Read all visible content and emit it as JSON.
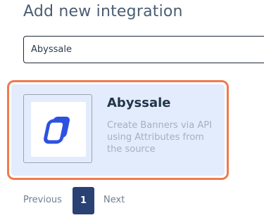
{
  "header": {
    "title": "Add new integration"
  },
  "search": {
    "value": "Abyssale",
    "placeholder": ""
  },
  "integration_card": {
    "name": "Abyssale",
    "description": "Create Banners via API using Attributes from the source",
    "logo_icon": "abyssale-logo-icon",
    "selected": true
  },
  "pagination": {
    "previous_label": "Previous",
    "current_page": "1",
    "next_label": "Next"
  },
  "colors": {
    "highlight_border": "#f07a4e",
    "card_background": "#e3ecfc",
    "logo_blue": "#2d52e0",
    "active_page_background": "#2a4173"
  }
}
